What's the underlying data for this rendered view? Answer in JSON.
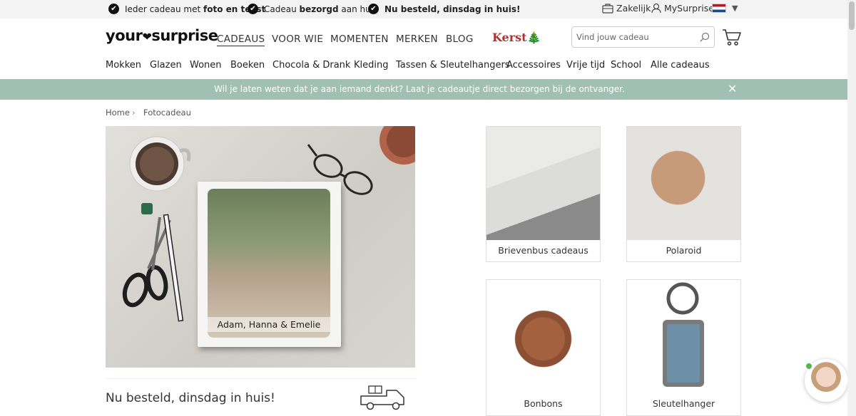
{
  "usp": [
    {
      "pre": "Ieder cadeau met ",
      "bold": "foto en tekst",
      "post": ""
    },
    {
      "pre": "Cadeau ",
      "bold": "bezorgd",
      "post": " aan huis"
    },
    {
      "pre": "",
      "bold": "Nu besteld, dinsdag in huis!",
      "post": ""
    }
  ],
  "topright": {
    "business": "Zakelijk",
    "account": "MySurprise"
  },
  "logo": {
    "left": "your",
    "right": "surprise"
  },
  "mainnav": [
    "CADEAUS",
    "VOOR WIE",
    "MOMENTEN",
    "MERKEN",
    "BLOG"
  ],
  "kerst": "Kerst",
  "search": {
    "placeholder": "Vind jouw cadeau"
  },
  "categories": [
    "Mokken",
    "Glazen",
    "Wonen",
    "Boeken",
    "Chocola & Drank",
    "Kleding",
    "Tassen & Sleutelhangers",
    "Accessoires",
    "Vrije tijd",
    "School",
    "Alle cadeaus"
  ],
  "notice": "Wil je laten weten dat je aan iemand denkt? Laat je cadeautje direct bezorgen bij de ontvanger.",
  "breadcrumb": [
    "Home",
    "Fotocadeau"
  ],
  "hero": {
    "caption": "Adam, Hanna & Emelie"
  },
  "delivery": "Nu besteld, dinsdag in huis!",
  "tiles": [
    "Brievenbus cadeaus",
    "Polaroid",
    "Bonbons",
    "Sleutelhanger"
  ],
  "colors": {
    "notice_bg": "#9fc0b2",
    "kerst_red": "#b4302b",
    "chat_online": "#51b84f"
  }
}
